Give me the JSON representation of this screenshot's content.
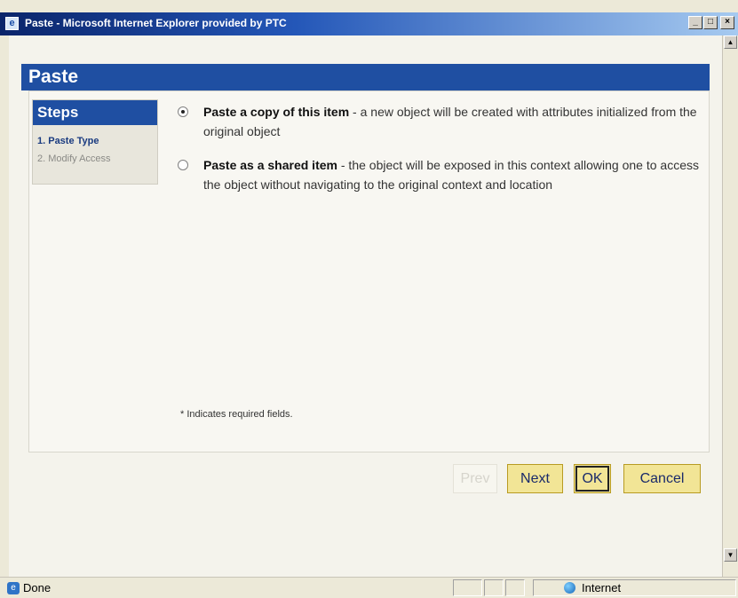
{
  "window": {
    "title": "Paste - Microsoft Internet Explorer provided by PTC",
    "controls": {
      "minimize": "_",
      "maximize": "□",
      "close": "×"
    }
  },
  "page": {
    "header": "Paste",
    "steps": {
      "title": "Steps",
      "items": [
        {
          "label": "1. Paste Type",
          "state": "active"
        },
        {
          "label": "2. Modify Access",
          "state": "inactive"
        }
      ]
    },
    "options": [
      {
        "bold": "Paste a copy of this item",
        "desc": " - a new object will be created with attributes initialized from the original object",
        "selected": true
      },
      {
        "bold": "Paste as a shared item",
        "desc": " - the object will be exposed in this context allowing one to access the object without navigating to the original context and location",
        "selected": false
      }
    ],
    "required_note": "* Indicates required fields."
  },
  "buttons": {
    "prev": "Prev",
    "next": "Next",
    "ok": "OK",
    "cancel": "Cancel"
  },
  "statusbar": {
    "status": "Done",
    "zone": "Internet"
  },
  "icons": {
    "app": "ie-icon",
    "status": "page-done-icon",
    "zone": "globe-icon"
  },
  "colors": {
    "header_blue": "#1f4fa2",
    "button_yellow": "#f2e596",
    "button_border": "#b89b22"
  }
}
